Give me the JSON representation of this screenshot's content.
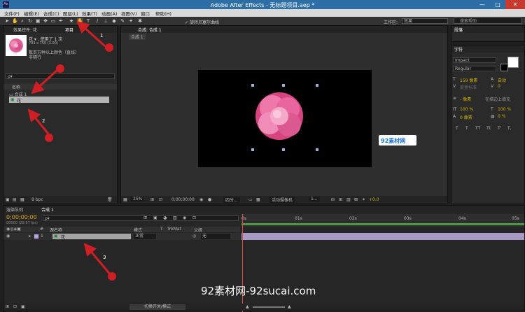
{
  "titlebar": {
    "icon": "Ae",
    "title": "Adobe After Effects - 无标题项目.aep *",
    "minimize": "—",
    "maximize": "□",
    "close": "✕"
  },
  "menu": [
    "文件(F)",
    "编辑(E)",
    "合成(C)",
    "图层(L)",
    "效果(T)",
    "动画(A)",
    "视图(V)",
    "窗口",
    "帮助(H)"
  ],
  "toolbar": {
    "snap_label": "旋转贝塞尔曲线",
    "workspace_label": "工作区:",
    "workspace_value": "效果",
    "help_placeholder": "搜索帮助"
  },
  "project_panel": {
    "tabs": [
      "效果控件: 花",
      "项目"
    ],
    "item_name": "花 ▾ , 使用了 1 次",
    "item_dims": "703 x 750 (1.00)",
    "item_desc1": "数百万种以上颜色（直线）",
    "item_desc2": "非隔行",
    "search_placeholder": "ρ▾",
    "column_name": "名称",
    "rows": [
      "合成 1",
      "花"
    ],
    "bpc": "8 bpc"
  },
  "comp_panel": {
    "tab": "合成: 合成 1",
    "sub_tab": "合成 1",
    "zoom": "25%",
    "timecode": "0;00;00;00",
    "quality": "四分...",
    "camera": "活动摄像机",
    "views": "1...",
    "exposure": "+0.0"
  },
  "watermark_badge": "92素材网",
  "watermark_text": "92素材网-92sucai.com",
  "right_panels": {
    "tab1": "段落",
    "tab2": "字符",
    "font": "Impact",
    "style": "Regular",
    "size": "159 像素",
    "leading": "自动",
    "tracking_label": "度量标准",
    "tracking": "0",
    "stroke": "- 像素",
    "stroke_opt": "在描边上填充",
    "vscale": "100 %",
    "hscale": "100 %",
    "baseline": "0 像素",
    "tsume": "0 %",
    "styles": [
      "T",
      "T",
      "TT",
      "Tt",
      "T'",
      "T,"
    ]
  },
  "timeline": {
    "tabs": [
      "渲染队列",
      "合成 1"
    ],
    "timecode": "0;00;00;00",
    "fps": "00000 (29.97 fps)",
    "search_placeholder": "ρ▾",
    "columns": [
      "#",
      "源名称",
      "模式",
      "T",
      "TrkMat",
      "父级"
    ],
    "layer_index": "1",
    "layer_name": "花",
    "layer_mode": "正常",
    "layer_parent": "无",
    "ruler": [
      "0s",
      "01s",
      "02s",
      "03s",
      "04s",
      "05s"
    ],
    "toggle_label": "切换开关/模式"
  },
  "annotations": [
    "1",
    "2",
    "3"
  ]
}
